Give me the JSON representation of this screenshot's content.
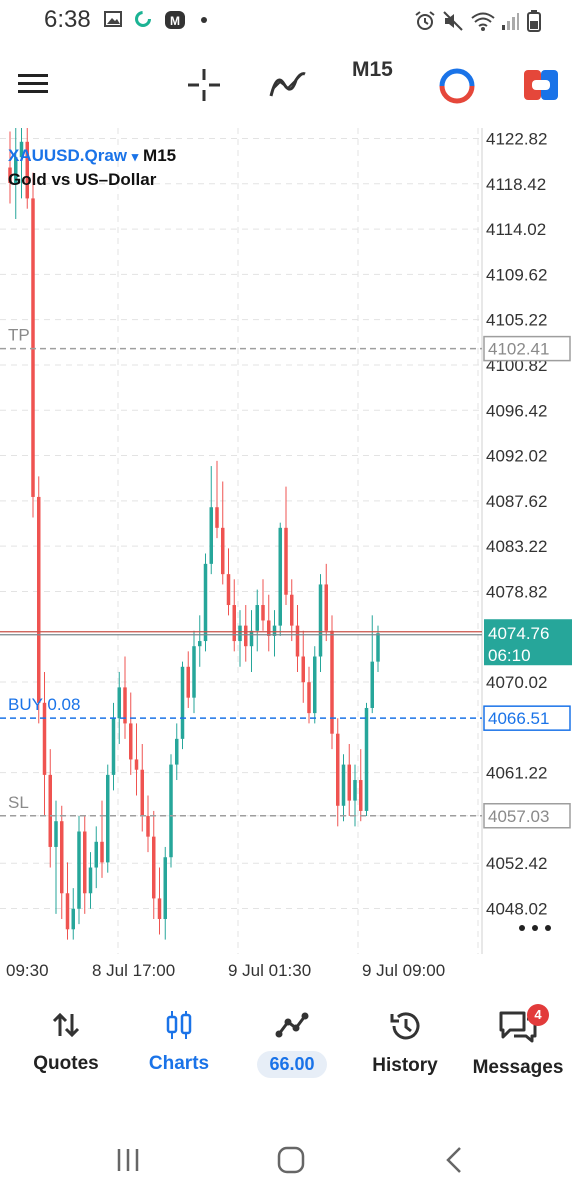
{
  "status_bar": {
    "time": "6:38",
    "icons_left": [
      "image-icon",
      "circle-loader-icon",
      "app-m-icon",
      "dot-icon"
    ],
    "icons_right": [
      "alarm-icon",
      "mute-icon",
      "wifi-icon",
      "signal-icon",
      "battery-icon"
    ]
  },
  "toolbar": {
    "timeframe": "M15",
    "icons": [
      "menu-icon",
      "crosshair-icon",
      "indicator-icon",
      "timeframe",
      "one-click-trading-icon",
      "trade-icon"
    ]
  },
  "chart": {
    "symbol": "XAUUSD.Qraw",
    "symbol_arrow": "▾",
    "timeframe": "M15",
    "description": "Gold vs US–Dollar",
    "price_axis": [
      "4122.82",
      "4118.42",
      "4114.02",
      "4109.62",
      "4105.22",
      "4100.82",
      "4096.42",
      "4092.02",
      "4087.62",
      "4083.22",
      "4078.82",
      "4074.76",
      "4070.02",
      "4066.51",
      "4061.22",
      "4057.03",
      "4052.42",
      "4048.02"
    ],
    "time_axis": [
      "09:30",
      "8 Jul 17:00",
      "9 Jul 01:30",
      "9 Jul 09:00"
    ],
    "current_price": "4074.76",
    "countdown": "06:10",
    "lines": {
      "tp": {
        "label": "TP",
        "price": "4102.41"
      },
      "buy": {
        "label": "BUY 0.08",
        "price": "4066.51"
      },
      "sl": {
        "label": "SL",
        "price": "4057.03"
      }
    },
    "more_icon": "more-horizontal-icon"
  },
  "chart_data": {
    "type": "candlestick",
    "ylim": [
      4045.0,
      4124.5
    ],
    "bull_color": "#26a69a",
    "bear_color": "#ef5350",
    "candles": [
      [
        4120.0,
        4123.5,
        4116.5,
        4118.5
      ],
      [
        4118.5,
        4124.0,
        4115.0,
        4121.0
      ],
      [
        4121.0,
        4124.5,
        4117.0,
        4122.5
      ],
      [
        4122.5,
        4124.5,
        4116.0,
        4117.0
      ],
      [
        4117.0,
        4119.5,
        4086.0,
        4088.0
      ],
      [
        4088.0,
        4090.0,
        4066.0,
        4068.0
      ],
      [
        4068.0,
        4071.0,
        4057.0,
        4061.0
      ],
      [
        4061.0,
        4063.5,
        4052.0,
        4054.0
      ],
      [
        4054.0,
        4058.5,
        4047.5,
        4056.5
      ],
      [
        4056.5,
        4058.0,
        4047.0,
        4049.5
      ],
      [
        4049.5,
        4052.5,
        4045.0,
        4046.0
      ],
      [
        4046.0,
        4050.0,
        4045.0,
        4048.0
      ],
      [
        4048.0,
        4057.0,
        4046.5,
        4055.5
      ],
      [
        4055.5,
        4057.0,
        4047.5,
        4049.5
      ],
      [
        4049.5,
        4053.5,
        4048.0,
        4052.0
      ],
      [
        4052.0,
        4056.0,
        4050.0,
        4054.5
      ],
      [
        4054.5,
        4058.5,
        4051.0,
        4052.5
      ],
      [
        4052.5,
        4062.0,
        4051.5,
        4061.0
      ],
      [
        4061.0,
        4068.0,
        4059.5,
        4066.5
      ],
      [
        4066.5,
        4071.0,
        4064.0,
        4069.5
      ],
      [
        4069.5,
        4072.5,
        4064.5,
        4066.0
      ],
      [
        4066.0,
        4069.0,
        4061.0,
        4062.5
      ],
      [
        4062.5,
        4066.0,
        4059.0,
        4061.5
      ],
      [
        4061.5,
        4064.0,
        4055.5,
        4057.0
      ],
      [
        4057.0,
        4059.0,
        4053.5,
        4055.0
      ],
      [
        4055.0,
        4057.5,
        4047.0,
        4049.0
      ],
      [
        4049.0,
        4052.0,
        4045.5,
        4047.0
      ],
      [
        4047.0,
        4054.0,
        4045.0,
        4053.0
      ],
      [
        4053.0,
        4063.0,
        4052.0,
        4062.0
      ],
      [
        4062.0,
        4066.0,
        4060.5,
        4064.5
      ],
      [
        4064.5,
        4072.0,
        4063.5,
        4071.5
      ],
      [
        4071.5,
        4073.0,
        4067.5,
        4068.5
      ],
      [
        4068.5,
        4075.0,
        4067.0,
        4073.5
      ],
      [
        4073.5,
        4076.5,
        4071.5,
        4074.0
      ],
      [
        4074.0,
        4082.5,
        4073.0,
        4081.5
      ],
      [
        4081.5,
        4091.0,
        4080.5,
        4087.0
      ],
      [
        4087.0,
        4091.5,
        4084.0,
        4085.0
      ],
      [
        4085.0,
        4089.5,
        4079.5,
        4080.5
      ],
      [
        4080.5,
        4083.0,
        4076.5,
        4077.5
      ],
      [
        4077.5,
        4080.0,
        4073.0,
        4074.0
      ],
      [
        4074.0,
        4077.0,
        4071.5,
        4075.5
      ],
      [
        4075.5,
        4077.5,
        4072.0,
        4073.5
      ],
      [
        4073.5,
        4077.0,
        4071.0,
        4075.0
      ],
      [
        4075.0,
        4079.0,
        4073.0,
        4077.5
      ],
      [
        4077.5,
        4080.0,
        4075.0,
        4076.0
      ],
      [
        4076.0,
        4078.5,
        4073.0,
        4074.5
      ],
      [
        4074.5,
        4077.0,
        4072.5,
        4075.5
      ],
      [
        4075.5,
        4085.5,
        4074.5,
        4085.0
      ],
      [
        4085.0,
        4089.0,
        4077.5,
        4078.5
      ],
      [
        4078.5,
        4080.0,
        4074.0,
        4075.5
      ],
      [
        4075.5,
        4077.5,
        4071.0,
        4072.5
      ],
      [
        4072.5,
        4075.0,
        4068.0,
        4070.0
      ],
      [
        4070.0,
        4071.5,
        4066.0,
        4067.0
      ],
      [
        4067.0,
        4073.5,
        4066.0,
        4072.5
      ],
      [
        4072.5,
        4080.5,
        4071.0,
        4079.5
      ],
      [
        4079.5,
        4081.5,
        4074.0,
        4075.0
      ],
      [
        4075.0,
        4076.5,
        4063.5,
        4065.0
      ],
      [
        4065.0,
        4066.5,
        4056.0,
        4058.0
      ],
      [
        4058.0,
        4063.0,
        4056.5,
        4062.0
      ],
      [
        4062.0,
        4064.0,
        4057.0,
        4058.5
      ],
      [
        4058.5,
        4062.0,
        4056.0,
        4060.5
      ],
      [
        4060.5,
        4063.5,
        4056.5,
        4057.5
      ],
      [
        4057.5,
        4068.0,
        4057.0,
        4067.5
      ],
      [
        4067.5,
        4076.5,
        4067.0,
        4072.0
      ],
      [
        4072.0,
        4075.5,
        4071.0,
        4074.76
      ]
    ]
  },
  "nav": {
    "items": [
      {
        "label": "Quotes",
        "icon": "quotes-arrows-icon"
      },
      {
        "label": "Charts",
        "icon": "candles-icon"
      },
      {
        "label": "66.00",
        "icon": "trade-line-icon"
      },
      {
        "label": "History",
        "icon": "history-icon"
      },
      {
        "label": "Messages",
        "icon": "messages-icon",
        "badge": "4"
      }
    ],
    "active": "Charts",
    "accent": "#1a73e8"
  },
  "system_nav": [
    "recents-icon",
    "home-icon",
    "back-icon"
  ]
}
